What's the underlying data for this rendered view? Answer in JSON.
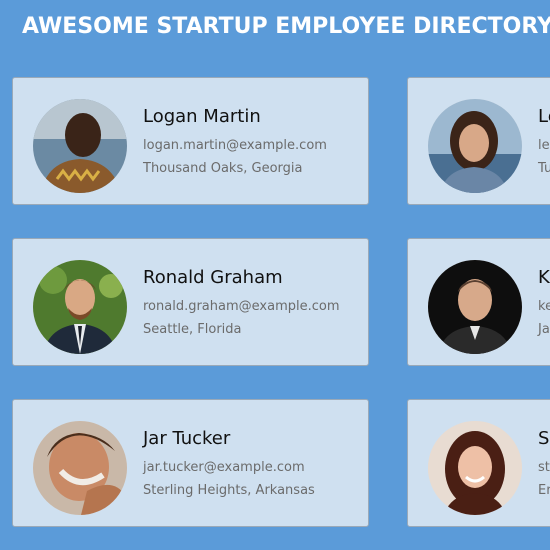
{
  "header": {
    "title": "AWESOME STARTUP EMPLOYEE DIRECTORY"
  },
  "employees": [
    {
      "name": "Logan Martin",
      "email": "logan.martin@example.com",
      "location": "Thousand Oaks, Georgia"
    },
    {
      "name": "Le",
      "email": "le",
      "location": "Tu"
    },
    {
      "name": "Ronald Graham",
      "email": "ronald.graham@example.com",
      "location": "Seattle, Florida"
    },
    {
      "name": "K",
      "email": "ke",
      "location": "Ja"
    },
    {
      "name": "Jar Tucker",
      "email": "jar.tucker@example.com",
      "location": "Sterling Heights, Arkansas"
    },
    {
      "name": "S",
      "email": "st",
      "location": "Er"
    }
  ],
  "colors": {
    "background": "#5b9bd9",
    "card": "#cfe0f0",
    "title": "#ffffff"
  }
}
